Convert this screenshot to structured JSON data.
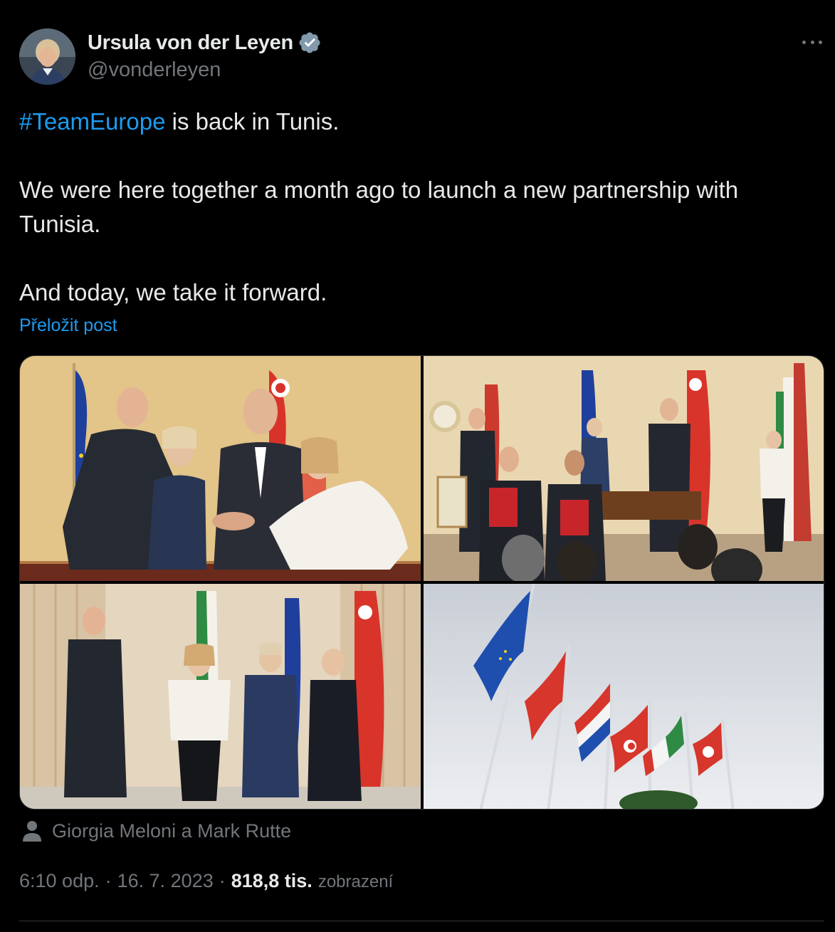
{
  "author": {
    "display_name": "Ursula von der Leyen",
    "handle": "@vonderleyen",
    "verified": true
  },
  "tweet": {
    "hashtag": "#TeamEurope",
    "line1_rest": " is back in Tunis.",
    "line2": "We were here together a month ago to launch a new partnership with",
    "line3": "Tunisia.",
    "line4": "And today, we take it forward.",
    "translate_label": "Přeložit post"
  },
  "tagged": {
    "text": "Giorgia Meloni a Mark Rutte"
  },
  "meta": {
    "time": "6:10 odp.",
    "date": "16. 7. 2023",
    "views_count": "818,8 tis.",
    "views_label": "zobrazení",
    "separator": "·"
  },
  "colors": {
    "background": "#000000",
    "text": "#e7e9ea",
    "secondary": "#71767b",
    "link": "#1d9bf0",
    "border": "#2f3336"
  },
  "icons": [
    "verified-badge-icon",
    "more-options-icon",
    "person-tag-icon"
  ]
}
